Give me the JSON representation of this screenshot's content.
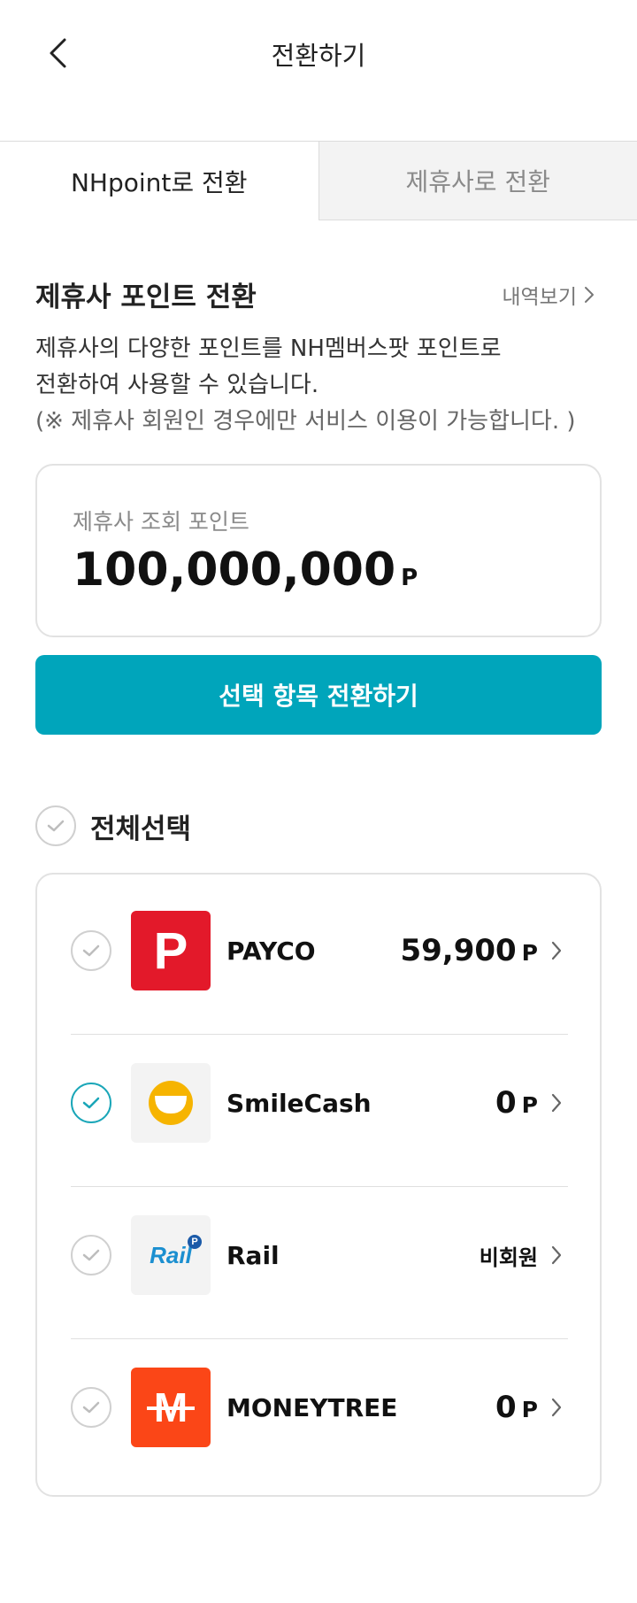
{
  "header": {
    "title": "전환하기",
    "back_icon": "chevron-left-icon"
  },
  "tabs": [
    {
      "label": "NHpoint로 전환",
      "active": true
    },
    {
      "label": "제휴사로 전환",
      "active": false
    }
  ],
  "section": {
    "title": "제휴사 포인트 전환",
    "history_label": "내역보기",
    "desc_line1": "제휴사의 다양한 포인트를 NH멤버스팟 포인트로",
    "desc_line2": "전환하여 사용할 수 있습니다.",
    "desc_note": "(※ 제휴사 회원인 경우에만 서비스 이용이 가능합니다. )"
  },
  "points_card": {
    "label": "제휴사 조회 포인트",
    "value": "100,000,000",
    "unit": "P"
  },
  "convert_button": {
    "label": "선택 항목 전환하기"
  },
  "select_all": {
    "label": "전체선택",
    "checked": false
  },
  "partners": [
    {
      "name": "PAYCO",
      "points": "59,900",
      "unit": "P",
      "checked": false,
      "logo": "payco-logo",
      "logo_text": "P",
      "logo_bg": "#e3192a"
    },
    {
      "name": "SmileCash",
      "points": "0",
      "unit": "P",
      "checked": true,
      "logo": "smilecash-logo",
      "logo_bg": "#f3f3f3"
    },
    {
      "name": "Rail",
      "status": "비회원",
      "checked": false,
      "logo": "rail-logo",
      "logo_text": "Rail",
      "logo_badge": "P",
      "logo_bg": "#f3f3f3"
    },
    {
      "name": "MONEYTREE",
      "points": "0",
      "unit": "P",
      "checked": false,
      "logo": "moneytree-logo",
      "logo_text": "M",
      "logo_bg": "#fb4617"
    }
  ],
  "colors": {
    "accent": "#00a5bb",
    "check_on": "#1aa6b8",
    "payco": "#e3192a",
    "moneytree": "#fb4617",
    "smile": "#f6b400",
    "rail": "#1b8fd0"
  }
}
